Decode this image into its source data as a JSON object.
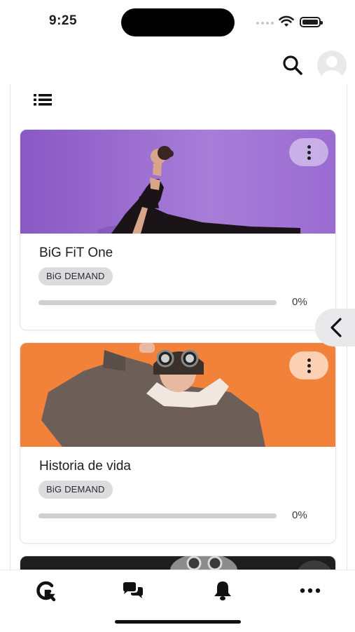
{
  "status_bar": {
    "time": "9:25"
  },
  "header": {
    "search_icon": "search-icon",
    "avatar_icon": "user-avatar-icon"
  },
  "toolbar": {
    "list_view_icon": "list-view-icon"
  },
  "courses": [
    {
      "title": "BiG FiT One",
      "badge": "BiG DEMAND",
      "progress": 0,
      "progress_label": "0%",
      "accent": "#9b6fd0"
    },
    {
      "title": "Historia de vida",
      "badge": "BiG DEMAND",
      "progress": 0,
      "progress_label": "0%",
      "accent": "#f08a3a"
    }
  ],
  "side_handle": {
    "icon": "chevron-left-icon"
  },
  "bottom_nav": [
    {
      "name": "home",
      "icon": "brand-logo-icon"
    },
    {
      "name": "chat",
      "icon": "chat-bubbles-icon"
    },
    {
      "name": "notifications",
      "icon": "bell-icon"
    },
    {
      "name": "more",
      "icon": "more-horizontal-icon"
    }
  ]
}
